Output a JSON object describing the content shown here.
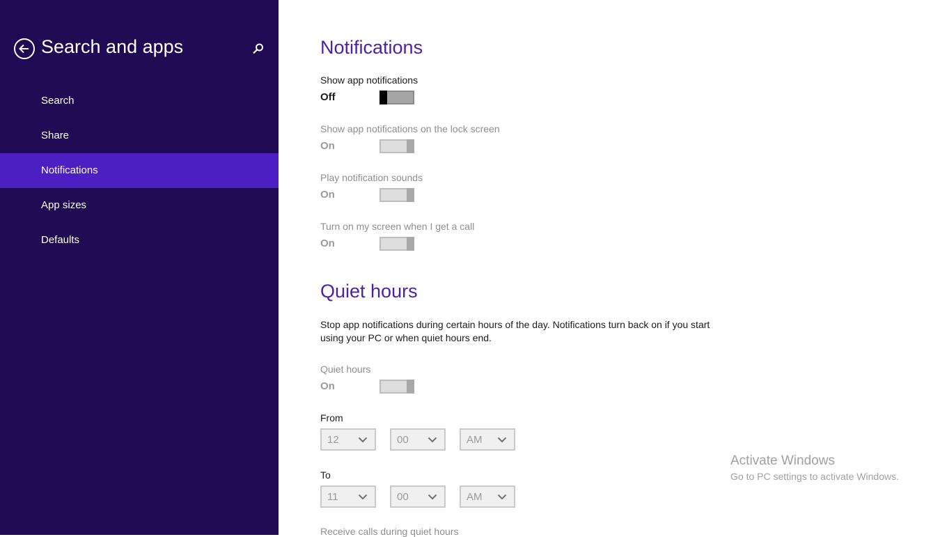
{
  "sidebar": {
    "title": "Search and apps",
    "items": [
      {
        "label": "Search"
      },
      {
        "label": "Share"
      },
      {
        "label": "Notifications"
      },
      {
        "label": "App sizes"
      },
      {
        "label": "Defaults"
      }
    ],
    "active_item": "Notifications",
    "background": "#1f0a53",
    "active_background": "#4b1fc1"
  },
  "notifications": {
    "title": "Notifications",
    "settings": [
      {
        "label": "Show app notifications",
        "state": "Off",
        "enabled": true
      },
      {
        "label": "Show app notifications on the lock screen",
        "state": "On",
        "enabled": false
      },
      {
        "label": "Play notification sounds",
        "state": "On",
        "enabled": false
      },
      {
        "label": "Turn on my screen when I get a call",
        "state": "On",
        "enabled": false
      }
    ]
  },
  "quiet_hours": {
    "title": "Quiet hours",
    "description": "Stop app notifications during certain hours of the day. Notifications turn back on if you start using your PC or when quiet hours end.",
    "toggle": {
      "label": "Quiet hours",
      "state": "On",
      "enabled": false
    },
    "from": {
      "label": "From",
      "hour": "12",
      "minute": "00",
      "period": "AM"
    },
    "to": {
      "label": "To",
      "hour": "11",
      "minute": "00",
      "period": "AM"
    },
    "receive_calls_label": "Receive calls during quiet hours"
  },
  "watermark": {
    "title": "Activate Windows",
    "subtitle": "Go to PC settings to activate Windows."
  },
  "icons": {
    "back": "back-arrow-icon",
    "search": "search-icon",
    "dropdown": "chevron-down-icon"
  },
  "colors": {
    "accent": "#4e1fa8",
    "text": "#1c1c1c",
    "disabled_text": "#9a9a9a"
  }
}
